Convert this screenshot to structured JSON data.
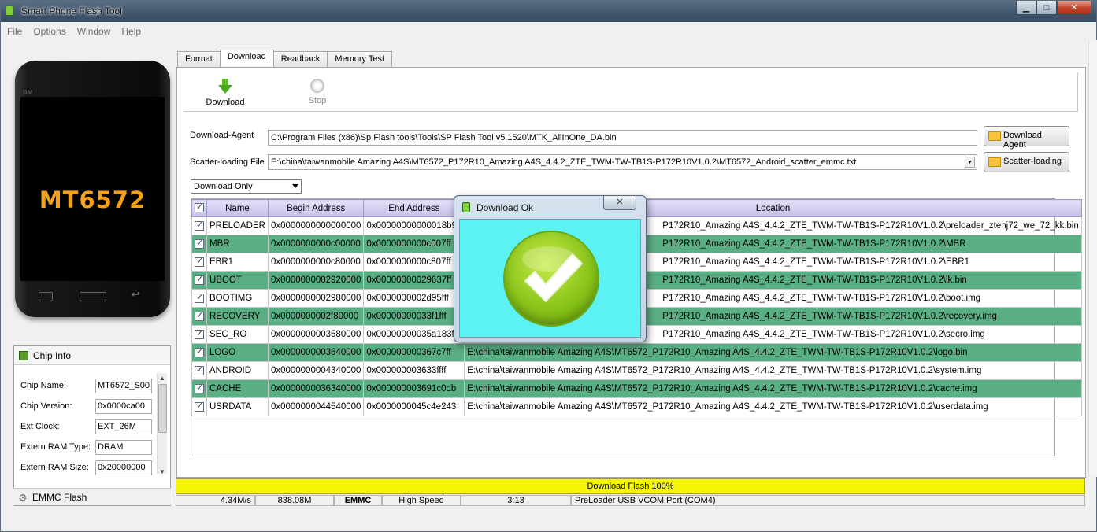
{
  "window": {
    "title": "Smart Phone Flash Tool"
  },
  "menu": [
    "File",
    "Options",
    "Window",
    "Help"
  ],
  "phone": {
    "brand": "BM",
    "chip": "MT6572"
  },
  "chip_info": {
    "title": "Chip Info",
    "rows": [
      {
        "label": "Chip Name:",
        "value": "MT6572_S00"
      },
      {
        "label": "Chip Version:",
        "value": "0x0000ca00"
      },
      {
        "label": "Ext Clock:",
        "value": "EXT_26M"
      },
      {
        "label": "Extern RAM Type:",
        "value": "DRAM"
      },
      {
        "label": "Extern RAM Size:",
        "value": "0x20000000"
      }
    ],
    "emmc_label": "EMMC Flash"
  },
  "tabs": [
    "Format",
    "Download",
    "Readback",
    "Memory Test"
  ],
  "active_tab": "Download",
  "toolbar": {
    "download_label": "Download",
    "stop_label": "Stop"
  },
  "download_agent": {
    "label": "Download-Agent",
    "value": "C:\\Program Files (x86)\\Sp Flash tools\\Tools\\SP Flash Tool v5.1520\\MTK_AllInOne_DA.bin",
    "button": "Download Agent"
  },
  "scatter": {
    "label": "Scatter-loading File",
    "value": "E:\\china\\taiwanmobile Amazing A4S\\MT6572_P172R10_Amazing A4S_4.4.2_ZTE_TWM-TW-TB1S-P172R10V1.0.2\\MT6572_Android_scatter_emmc.txt",
    "button": "Scatter-loading"
  },
  "mode": {
    "selected": "Download Only"
  },
  "table": {
    "headers": [
      "Name",
      "Begin Address",
      "End Address",
      "Location"
    ],
    "rows": [
      {
        "name": "PRELOADER",
        "begin": "0x0000000000000000",
        "end": "0x00000000000018b9b",
        "loc_prefix": "",
        "loc": "P172R10_Amazing A4S_4.4.2_ZTE_TWM-TW-TB1S-P172R10V1.0.2\\preloader_ztenj72_we_72_kk.bin",
        "green": false
      },
      {
        "name": "MBR",
        "begin": "0x0000000000c00000",
        "end": "0x0000000000c007ff",
        "loc_prefix": "E",
        "loc": "P172R10_Amazing A4S_4.4.2_ZTE_TWM-TW-TB1S-P172R10V1.0.2\\MBR",
        "green": true
      },
      {
        "name": "EBR1",
        "begin": "0x0000000000c80000",
        "end": "0x0000000000c807ff",
        "loc_prefix": "E",
        "loc": "P172R10_Amazing A4S_4.4.2_ZTE_TWM-TW-TB1S-P172R10V1.0.2\\EBR1",
        "green": false
      },
      {
        "name": "UBOOT",
        "begin": "0x0000000002920000",
        "end": "0x00000000029637ff",
        "loc_prefix": "E",
        "loc": "P172R10_Amazing A4S_4.4.2_ZTE_TWM-TW-TB1S-P172R10V1.0.2\\lk.bin",
        "green": true
      },
      {
        "name": "BOOTIMG",
        "begin": "0x0000000002980000",
        "end": "0x0000000002d95fff",
        "loc_prefix": "E",
        "loc": "P172R10_Amazing A4S_4.4.2_ZTE_TWM-TW-TB1S-P172R10V1.0.2\\boot.img",
        "green": false
      },
      {
        "name": "RECOVERY",
        "begin": "0x0000000002f80000",
        "end": "0x00000000033f1fff",
        "loc_prefix": "E",
        "loc": "P172R10_Amazing A4S_4.4.2_ZTE_TWM-TW-TB1S-P172R10V1.0.2\\recovery.img",
        "green": true
      },
      {
        "name": "SEC_RO",
        "begin": "0x0000000003580000",
        "end": "0x00000000035a183f",
        "loc_prefix": "E",
        "loc": "P172R10_Amazing A4S_4.4.2_ZTE_TWM-TW-TB1S-P172R10V1.0.2\\secro.img",
        "green": false
      },
      {
        "name": "LOGO",
        "begin": "0x0000000003640000",
        "end": "0x000000000367c7ff",
        "loc_prefix": "",
        "loc": "E:\\china\\taiwanmobile Amazing A4S\\MT6572_P172R10_Amazing A4S_4.4.2_ZTE_TWM-TW-TB1S-P172R10V1.0.2\\logo.bin",
        "green": true
      },
      {
        "name": "ANDROID",
        "begin": "0x0000000004340000",
        "end": "0x000000003633ffff",
        "loc_prefix": "",
        "loc": "E:\\china\\taiwanmobile Amazing A4S\\MT6572_P172R10_Amazing A4S_4.4.2_ZTE_TWM-TW-TB1S-P172R10V1.0.2\\system.img",
        "green": false
      },
      {
        "name": "CACHE",
        "begin": "0x0000000036340000",
        "end": "0x000000003691c0db",
        "loc_prefix": "",
        "loc": "E:\\china\\taiwanmobile Amazing A4S\\MT6572_P172R10_Amazing A4S_4.4.2_ZTE_TWM-TW-TB1S-P172R10V1.0.2\\cache.img",
        "green": true
      },
      {
        "name": "USRDATA",
        "begin": "0x0000000044540000",
        "end": "0x0000000045c4e243",
        "loc_prefix": "",
        "loc": "E:\\china\\taiwanmobile Amazing A4S\\MT6572_P172R10_Amazing A4S_4.4.2_ZTE_TWM-TW-TB1S-P172R10V1.0.2\\userdata.img",
        "green": false
      }
    ]
  },
  "progress": {
    "text": "Download Flash 100%",
    "percent": 100
  },
  "status": {
    "speed": "4.34M/s",
    "size": "838.08M",
    "storage": "EMMC",
    "usb": "High Speed",
    "time": "3:13",
    "port": "PreLoader USB VCOM Port (COM4)"
  },
  "dialog": {
    "title": "Download Ok"
  },
  "colors": {
    "progress": "#f6f600",
    "row_green": "#5aae84",
    "dialog_body": "#5cf2f4",
    "chip_text": "#f5a01a"
  }
}
